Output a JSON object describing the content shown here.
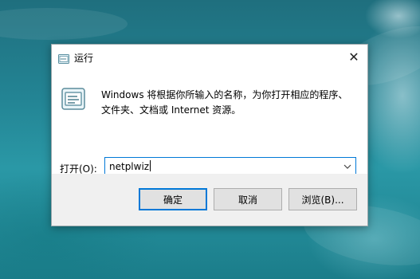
{
  "dialog": {
    "title": "运行",
    "close_glyph": "✕",
    "description_line1": "Windows 将根据你所输入的名称，为你打开相应的程序、",
    "description_line2": "文件夹、文档或 Internet 资源。",
    "open_label": "打开(O):",
    "input_value": "netplwiz",
    "buttons": {
      "ok": "确定",
      "cancel": "取消",
      "browse": "浏览(B)..."
    }
  },
  "icons": {
    "title": "run-app-icon",
    "main": "run-app-icon",
    "close": "close-icon",
    "dropdown": "chevron-down-icon"
  },
  "colors": {
    "accent": "#0078d7",
    "footer_bg": "#f0f0f0",
    "button_bg": "#e1e1e1"
  }
}
